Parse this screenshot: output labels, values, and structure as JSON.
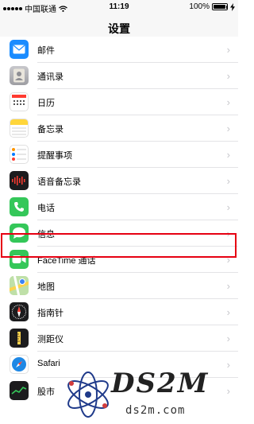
{
  "status": {
    "carrier": "中国联通",
    "time": "11:19",
    "battery": "100%"
  },
  "nav": {
    "title": "设置"
  },
  "rows": [
    {
      "label": "邮件",
      "icon": "mail-icon",
      "color": "#1a8cff"
    },
    {
      "label": "通讯录",
      "icon": "contacts-icon",
      "color": "#a9a9ad"
    },
    {
      "label": "日历",
      "icon": "calendar-icon",
      "color": "#ffffff"
    },
    {
      "label": "备忘录",
      "icon": "notes-icon",
      "color": "#ffd63b"
    },
    {
      "label": "提醒事项",
      "icon": "reminders-icon",
      "color": "#ffffff"
    },
    {
      "label": "语音备忘录",
      "icon": "voice-memos-icon",
      "color": "#1c1c1e"
    },
    {
      "label": "电话",
      "icon": "phone-icon",
      "color": "#34c759"
    },
    {
      "label": "信息",
      "icon": "messages-icon",
      "color": "#34c759"
    },
    {
      "label": "FaceTime 通话",
      "icon": "facetime-icon",
      "color": "#34c759"
    },
    {
      "label": "地图",
      "icon": "maps-icon",
      "color": "#7cc46d"
    },
    {
      "label": "指南针",
      "icon": "compass-icon",
      "color": "#1c1c1e"
    },
    {
      "label": "测距仪",
      "icon": "measure-icon",
      "color": "#1c1c1e"
    },
    {
      "label": "Safari",
      "icon": "safari-icon",
      "color": "#1e88e5"
    },
    {
      "label": "股市",
      "icon": "stocks-icon",
      "color": "#1c1c1e"
    }
  ],
  "watermark": {
    "logo": "DS2M",
    "site": "ds2m.com"
  }
}
